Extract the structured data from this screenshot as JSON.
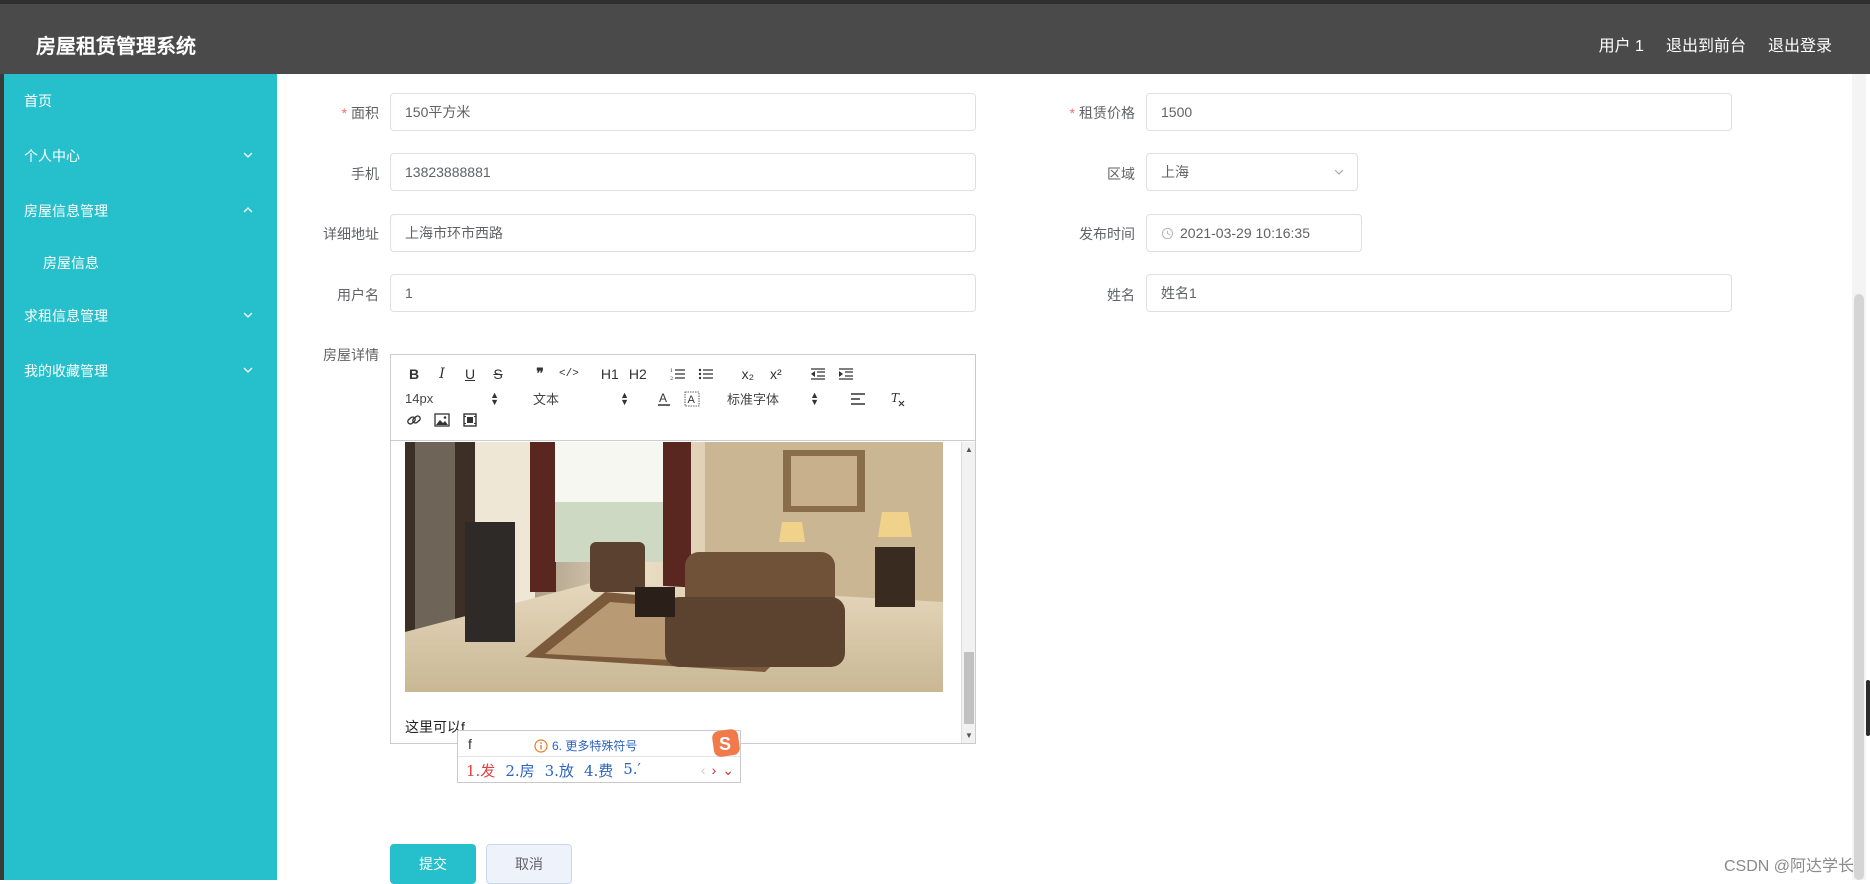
{
  "header": {
    "app_title": "房屋租赁管理系统",
    "links": [
      "用户 1",
      "退出到前台",
      "退出登录"
    ]
  },
  "sidebar": {
    "items": [
      {
        "label": "首页"
      },
      {
        "label": "个人中心",
        "icon": "chevron-down-icon"
      },
      {
        "label": "房屋信息管理",
        "icon": "chevron-up-icon"
      },
      {
        "label": "房屋信息"
      },
      {
        "label": "求租信息管理",
        "icon": "chevron-down-icon"
      },
      {
        "label": "我的收藏管理",
        "icon": "chevron-down-icon"
      }
    ]
  },
  "form": {
    "area": {
      "label": "面积",
      "required": true,
      "value": "150平方米"
    },
    "price": {
      "label": "租赁价格",
      "required": true,
      "value": "1500"
    },
    "phone": {
      "label": "手机",
      "value": "13823888881"
    },
    "region": {
      "label": "区域",
      "value": "上海"
    },
    "address": {
      "label": "详细地址",
      "value": "上海市环市西路"
    },
    "publish_time": {
      "label": "发布时间",
      "value": "2021-03-29 10:16:35"
    },
    "username": {
      "label": "用户名",
      "value": "1"
    },
    "name": {
      "label": "姓名",
      "value": "姓名1"
    },
    "details": {
      "label": "房屋详情"
    }
  },
  "editor": {
    "toolbar_row1": [
      "B",
      "I",
      "U",
      "S",
      "❞",
      "</>",
      "H1",
      "H2",
      "ol",
      "ul",
      "x₂",
      "x²",
      "outdent",
      "indent"
    ],
    "font_size": "14px",
    "block_type": "文本",
    "font_family": "标准字体",
    "content_text": "这里可以f"
  },
  "ime": {
    "pinyin": "f",
    "hint": "6. 更多特殊符号",
    "candidates": [
      "1.发",
      "2.房",
      "3.放",
      "4.费",
      "5.′"
    ]
  },
  "buttons": {
    "submit": "提交",
    "cancel": "取消"
  },
  "watermark": "CSDN @阿达学长",
  "colors": {
    "accent": "#26c0cc",
    "header_bg": "#4a4a4a",
    "required": "#f56c6c"
  }
}
